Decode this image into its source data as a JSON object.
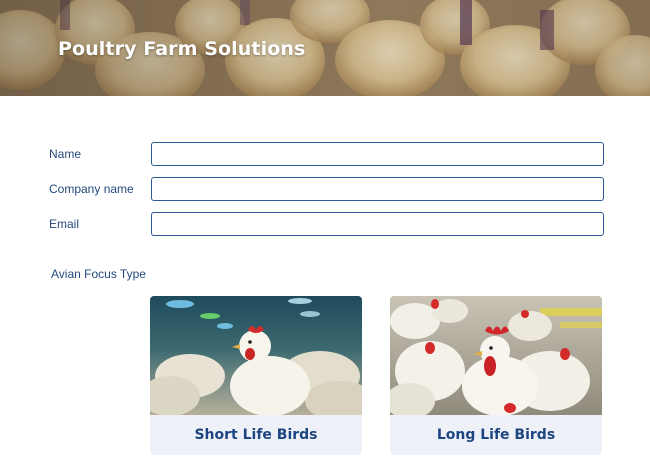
{
  "header": {
    "title": "Poultry Farm Solutions"
  },
  "form": {
    "name_label": "Name",
    "name_value": "",
    "company_label": "Company name",
    "company_value": "",
    "email_label": "Email",
    "email_value": ""
  },
  "avian_focus": {
    "label": "Avian Focus Type",
    "options": [
      {
        "label": "Short Life Birds"
      },
      {
        "label": "Long Life Birds"
      }
    ]
  },
  "colors": {
    "accent": "#1d4580",
    "input_border": "#2d5a94",
    "card_bg": "#eef2f8"
  }
}
